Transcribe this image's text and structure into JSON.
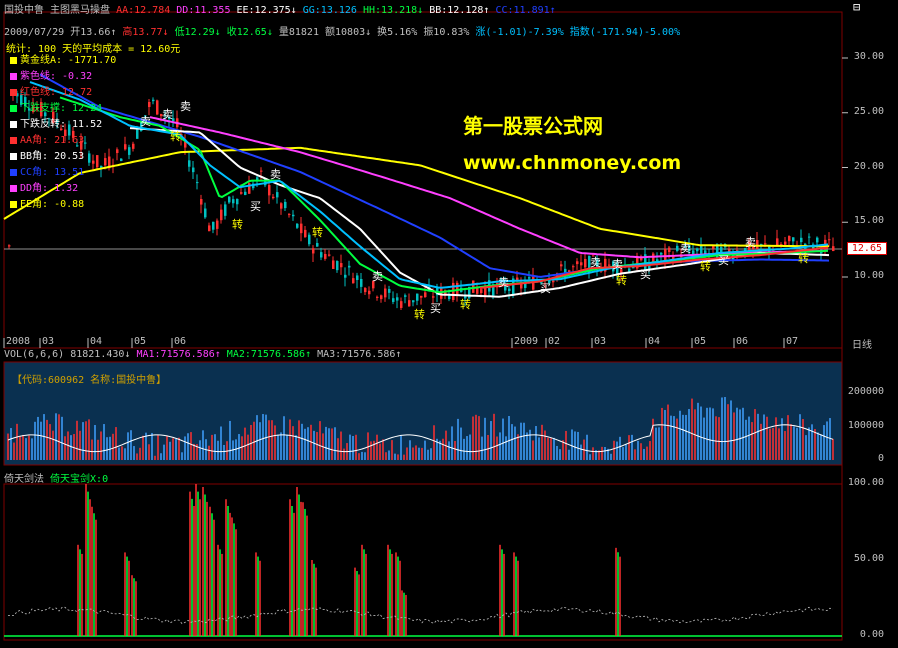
{
  "colors": {
    "bg": "#000000",
    "up": "#ff3030",
    "down": "#00c0c0",
    "grid": "#800000",
    "yellow": "#ffff00",
    "magenta": "#ff40ff",
    "blue": "#2040ff",
    "white": "#ffffff",
    "green": "#00ff40",
    "cyan": "#00c0ff",
    "watermark": "#ffff00"
  },
  "header": {
    "stock_name": "国投中鲁",
    "chart_type": "主图黑马操盘",
    "aa": "AA:12.784",
    "dd": "DD:11.355",
    "ee": "EE:12.375↓",
    "gg": "GG:13.126",
    "hh": "HH:13.218↓",
    "bb": "BB:12.128↑",
    "cc": "CC:11.891↑",
    "date": "2009/07/29",
    "open": "开13.66↑",
    "high": "高13.77↓",
    "low": "低12.29↓",
    "close": "收12.65↓",
    "volume": "量81821",
    "amount": "额10803↓",
    "turnover": "换5.16%",
    "amplitude": "振10.83%",
    "change": "涨(-1.01)-7.39%",
    "index": "指数(-171.94)-5.00%",
    "stat": "统计: 100 天的平均成本 = 12.60元"
  },
  "legend": [
    {
      "label": "黄金线A: -1771.70",
      "color": "#ffff00"
    },
    {
      "label": "紫色线: -0.32",
      "color": "#ff40ff"
    },
    {
      "label": "红色线: 12.72",
      "color": "#ff3030"
    },
    {
      "label": "下跌支撑: 12.24",
      "color": "#00ff40"
    },
    {
      "label": "下跌反转: 11.52",
      "color": "#ffffff"
    },
    {
      "label": "AA角: 21.63",
      "color": "#ff3030"
    },
    {
      "label": "BB角: 20.53",
      "color": "#ffffff"
    },
    {
      "label": "CC角: 13.51",
      "color": "#2040ff"
    },
    {
      "label": "DD角: 1.32",
      "color": "#ff40ff"
    },
    {
      "label": "EE角: -0.88",
      "color": "#ffff00"
    }
  ],
  "price_axis": [
    "30.00",
    "25.00",
    "20.00",
    "15.00",
    "10.00"
  ],
  "price_tag": "12.65",
  "dates": [
    "2008",
    "03",
    "04",
    "05",
    "06",
    "2009",
    "02",
    "03",
    "04",
    "05",
    "06",
    "07"
  ],
  "period": "日线",
  "watermark": {
    "title": "第一股票公式网",
    "url": "www.chnmoney.com"
  },
  "volume_panel": {
    "header": "VOL(6,6,6) 81821.430↓",
    "ma1": "MA1:71576.586↑",
    "ma2": "MA2:71576.586↑",
    "ma3": "MA3:71576.586↑",
    "stock_info": "【代码:600962 名称:国投中鲁】",
    "axis": [
      "200000",
      "100000",
      "0"
    ]
  },
  "indicator_panel": {
    "name": "倚天剑法",
    "line": "倚天宝剑X:0",
    "axis": [
      "100.00",
      "50.00",
      "0.00"
    ]
  },
  "signals": [
    {
      "text": "卖",
      "color": "#ffffff"
    },
    {
      "text": "买",
      "color": "#ffffff"
    },
    {
      "text": "转",
      "color": "#ffff00"
    }
  ]
}
